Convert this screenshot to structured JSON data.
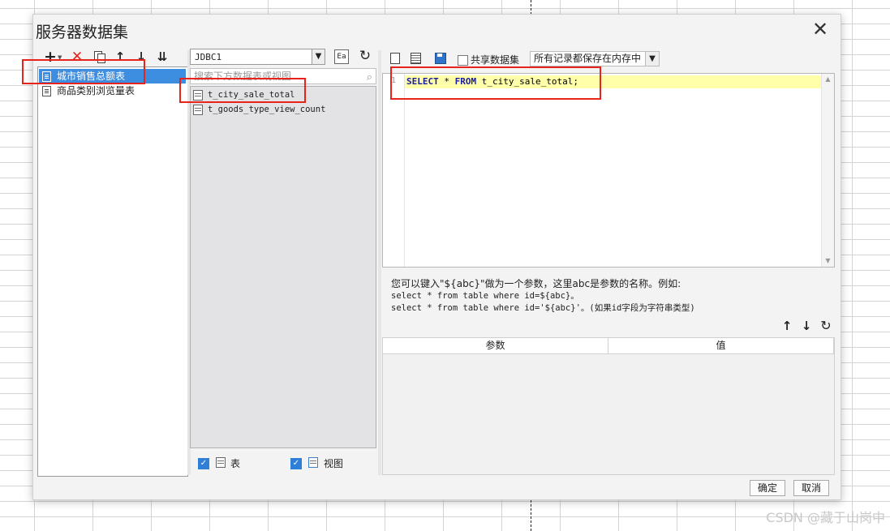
{
  "dialog": {
    "title": "服务器数据集"
  },
  "left": {
    "datasets": [
      {
        "label": "城市销售总额表",
        "selected": true
      },
      {
        "label": "商品类别浏览量表",
        "selected": false
      }
    ]
  },
  "middle": {
    "connection": "JDBC1",
    "search_placeholder": "搜索下方数据表或视图",
    "tables": [
      {
        "label": "t_city_sale_total"
      },
      {
        "label": "t_goods_type_view_count"
      }
    ],
    "filter_table_label": "表",
    "filter_view_label": "视图"
  },
  "right": {
    "share_label": "共享数据集",
    "cache_mode": "所有记录都保存在内存中",
    "sql": {
      "line_number": "1",
      "kw_select": "SELECT",
      "star": " * ",
      "kw_from": "FROM",
      "rest": " t_city_sale_total;"
    },
    "hint": {
      "line1": "您可以键入\"${abc}\"做为一个参数，这里abc是参数的名称。例如:",
      "line2": "select * from table where id=${abc}。",
      "line3": "select * from table where id='${abc}'。(如果id字段为字符串类型)"
    },
    "params": {
      "col_param": "参数",
      "col_value": "值"
    }
  },
  "footer": {
    "ok": "确定",
    "cancel": "取消"
  },
  "watermark": "CSDN @藏于山岗中",
  "colors": {
    "selection": "#3d8ee0",
    "highlight_box": "#e8231b",
    "current_line": "#ffffaa",
    "keyword": "#1a1aa6"
  }
}
